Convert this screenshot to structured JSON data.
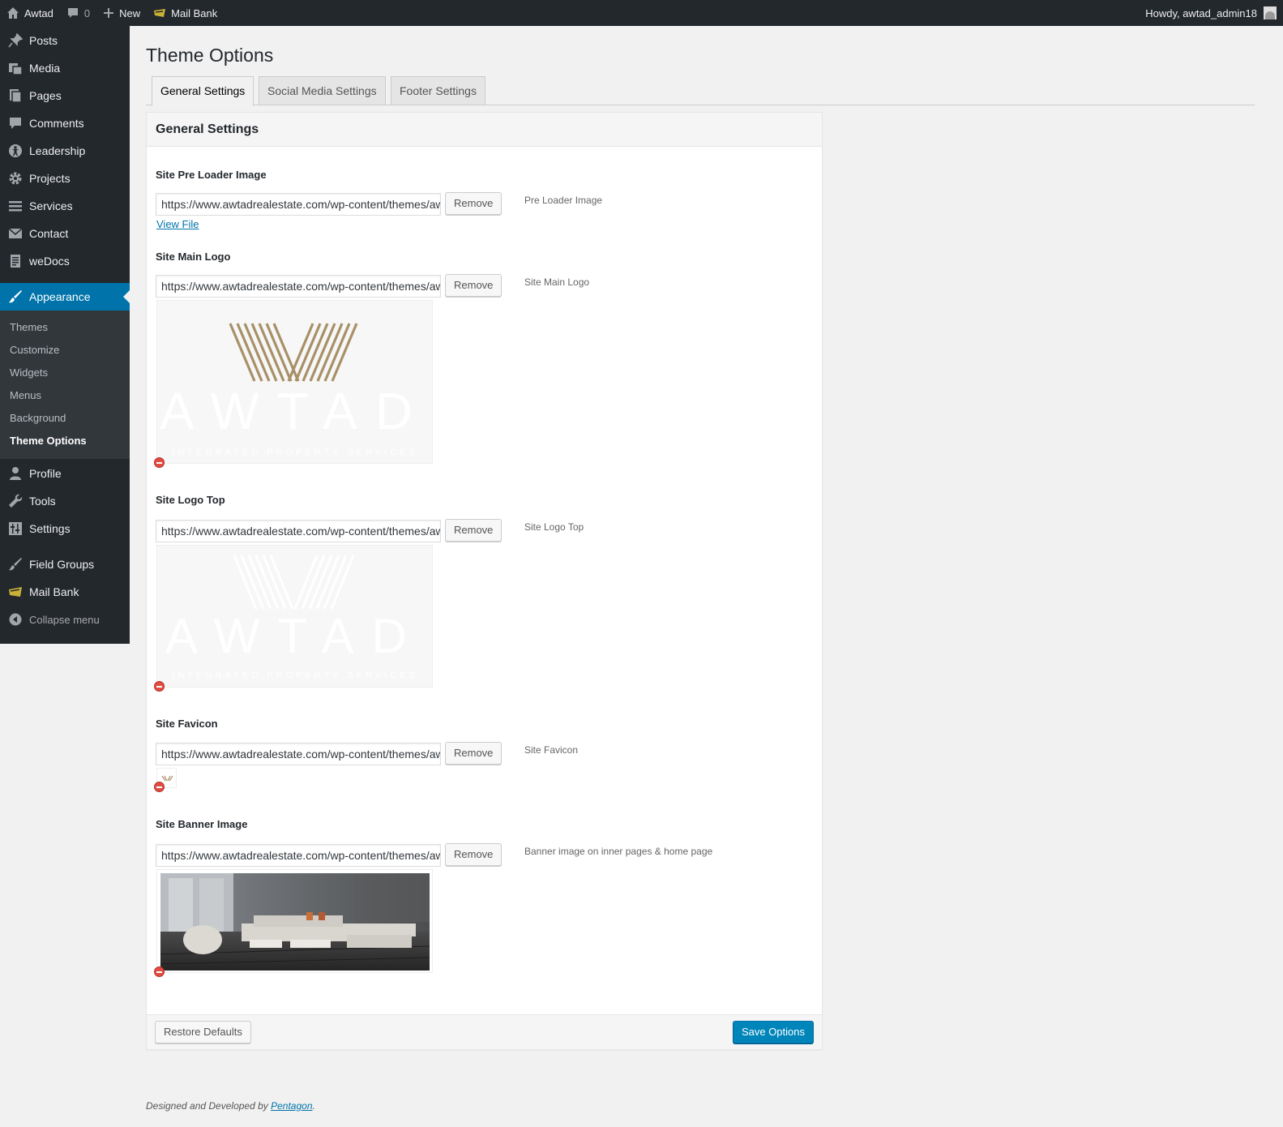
{
  "adminbar": {
    "site_name": "Awtad",
    "comments_count": "0",
    "new_label": "New",
    "mailbank_label": "Mail Bank",
    "howdy": "Howdy, awtad_admin18"
  },
  "sidebar": {
    "items": [
      {
        "label": "Posts",
        "icon": "pushpin-icon"
      },
      {
        "label": "Media",
        "icon": "media-icon"
      },
      {
        "label": "Pages",
        "icon": "pages-icon"
      },
      {
        "label": "Comments",
        "icon": "comment-icon"
      },
      {
        "label": "Leadership",
        "icon": "person-icon"
      },
      {
        "label": "Projects",
        "icon": "gear-icon"
      },
      {
        "label": "Services",
        "icon": "list-icon"
      },
      {
        "label": "Contact",
        "icon": "mail-icon"
      },
      {
        "label": "weDocs",
        "icon": "doc-icon"
      }
    ],
    "appearance_label": "Appearance",
    "submenu": [
      "Themes",
      "Customize",
      "Widgets",
      "Menus",
      "Background",
      "Theme Options"
    ],
    "items2": [
      {
        "label": "Profile",
        "icon": "user-icon"
      },
      {
        "label": "Tools",
        "icon": "wrench-icon"
      },
      {
        "label": "Settings",
        "icon": "settings-icon"
      }
    ],
    "items3": [
      {
        "label": "Field Groups",
        "icon": "field-icon"
      },
      {
        "label": "Mail Bank",
        "icon": "mailbank-icon"
      }
    ],
    "collapse_label": "Collapse menu"
  },
  "main": {
    "page_title": "Theme Options",
    "tabs": [
      "General Settings",
      "Social Media Settings",
      "Footer Settings"
    ],
    "panel_title": "General Settings",
    "fields": [
      {
        "label": "Site Pre Loader Image",
        "value": "https://www.awtadrealestate.com/wp-content/themes/awtad/images/loader.gif",
        "remove": "Remove",
        "desc": "Pre Loader Image",
        "view_file": "View File"
      },
      {
        "label": "Site Main Logo",
        "value": "https://www.awtadrealestate.com/wp-content/themes/awtad/images/logo.png",
        "remove": "Remove",
        "desc": "Site Main Logo"
      },
      {
        "label": "Site Logo Top",
        "value": "https://www.awtadrealestate.com/wp-content/themes/awtad/images/logo-top.png",
        "remove": "Remove",
        "desc": "Site Logo Top"
      },
      {
        "label": "Site Favicon",
        "value": "https://www.awtadrealestate.com/wp-content/themes/awtad/images/favicon.png",
        "remove": "Remove",
        "desc": "Site Favicon"
      },
      {
        "label": "Site Banner Image",
        "value": "https://www.awtadrealestate.com/wp-content/themes/awtad/images/banner.jpg",
        "remove": "Remove",
        "desc": "Banner image on inner pages & home page"
      }
    ],
    "logo_text": "AWTAD",
    "logo_subtext": "INTEGRATED PROPERTY SERVICES",
    "restore_label": "Restore Defaults",
    "save_label": "Save Options"
  },
  "footer": {
    "prefix": "Designed and Developed by ",
    "link": "Pentagon",
    "suffix": "."
  },
  "colors": {
    "adminbar_bg": "#23282d",
    "accent": "#0073aa",
    "primary_button": "#0085ba",
    "logo_gold": "#a89068"
  }
}
